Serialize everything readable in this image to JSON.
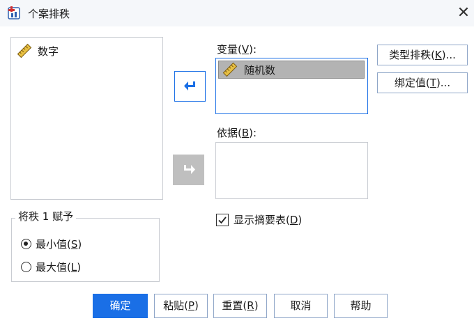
{
  "window": {
    "title": "个案排秩",
    "close_glyph": "✕"
  },
  "source_list": {
    "items": [
      {
        "label": "数字",
        "icon": "ruler-icon"
      }
    ]
  },
  "variable_field": {
    "label_pre": "变量(",
    "label_key": "V",
    "label_post": "):",
    "items": [
      {
        "label": "随机数",
        "icon": "ruler-icon",
        "selected": true
      }
    ]
  },
  "by_field": {
    "label_pre": "依据(",
    "label_key": "B",
    "label_post": "):",
    "items": []
  },
  "side_buttons": {
    "rank_types": {
      "pre": "类型排秩(",
      "key": "K",
      "post": ")..."
    },
    "ties": {
      "pre": "绑定值(",
      "key": "T",
      "post": ")..."
    }
  },
  "assign_rank": {
    "title": "将秩 1 赋予",
    "options": [
      {
        "pre": "最小值(",
        "key": "S",
        "post": ")",
        "checked": true
      },
      {
        "pre": "最大值(",
        "key": "L",
        "post": ")",
        "checked": false
      }
    ]
  },
  "summary": {
    "pre": "显示摘要表(",
    "key": "D",
    "post": ")",
    "checked": true
  },
  "buttons": {
    "ok": "确定",
    "paste": {
      "pre": "粘贴(",
      "key": "P",
      "post": ")"
    },
    "reset": {
      "pre": "重置(",
      "key": "R",
      "post": ")"
    },
    "cancel": "取消",
    "help": "帮助"
  },
  "colors": {
    "accent": "#1a6fe6",
    "selection": "#b3b3b3",
    "disabled": "#bfbfbf"
  }
}
